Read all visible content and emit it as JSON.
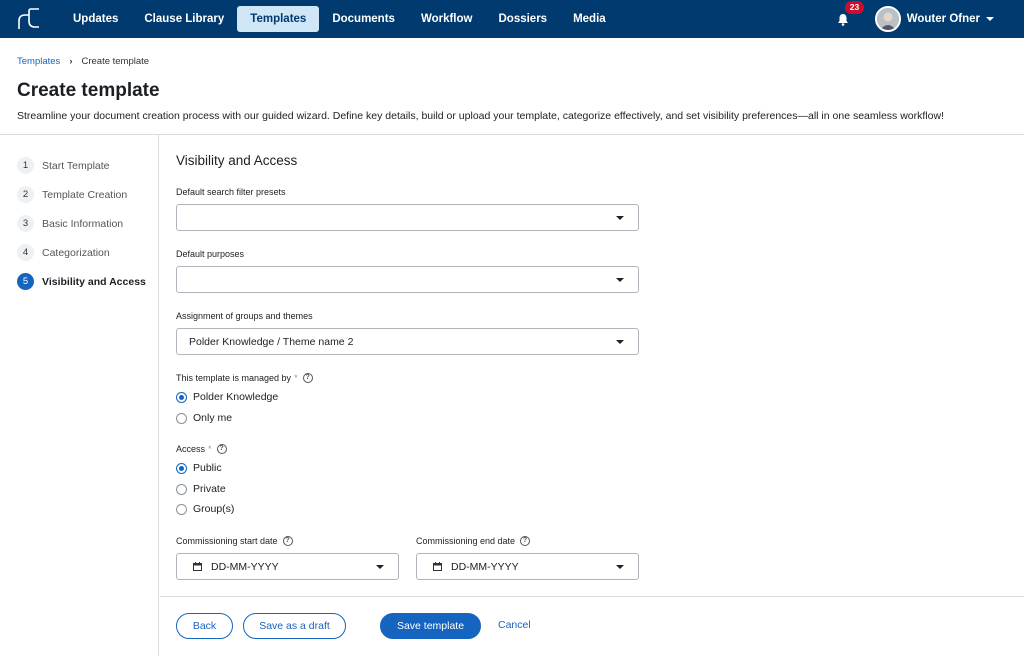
{
  "nav": {
    "items": [
      {
        "label": "Updates",
        "active": false
      },
      {
        "label": "Clause Library",
        "active": false
      },
      {
        "label": "Templates",
        "active": true
      },
      {
        "label": "Documents",
        "active": false
      },
      {
        "label": "Workflow",
        "active": false
      },
      {
        "label": "Dossiers",
        "active": false
      },
      {
        "label": "Media",
        "active": false
      }
    ],
    "notification_count": "23",
    "user_name": "Wouter Ofner"
  },
  "breadcrumb": {
    "parent": "Templates",
    "current": "Create template"
  },
  "page": {
    "title": "Create template",
    "description": "Streamline your document creation process with our guided wizard. Define key details, build or upload your template, categorize effectively, and set visibility preferences—all in one seamless workflow!"
  },
  "steps": [
    {
      "num": "1",
      "label": "Start Template",
      "active": false
    },
    {
      "num": "2",
      "label": "Template Creation",
      "active": false
    },
    {
      "num": "3",
      "label": "Basic Information",
      "active": false
    },
    {
      "num": "4",
      "label": "Categorization",
      "active": false
    },
    {
      "num": "5",
      "label": "Visibility and Access",
      "active": true
    }
  ],
  "form": {
    "section_title": "Visibility and Access",
    "filter_presets": {
      "label": "Default search filter presets",
      "value": ""
    },
    "purposes": {
      "label": "Default purposes",
      "value": ""
    },
    "groups_themes": {
      "label": "Assignment of groups and themes",
      "value": "Polder Knowledge / Theme name 2"
    },
    "managed_by": {
      "label": "This template is managed by",
      "required_mark": "*",
      "options": [
        {
          "label": "Polder Knowledge",
          "checked": true
        },
        {
          "label": "Only me",
          "checked": false
        }
      ]
    },
    "access": {
      "label": "Access",
      "required_mark": "*",
      "options": [
        {
          "label": "Public",
          "checked": true
        },
        {
          "label": "Private",
          "checked": false
        },
        {
          "label": "Group(s)",
          "checked": false
        }
      ]
    },
    "start_date": {
      "label": "Commissioning start date",
      "placeholder": "DD-MM-YYYY"
    },
    "end_date": {
      "label": "Commissioning end date",
      "placeholder": "DD-MM-YYYY"
    }
  },
  "actions": {
    "back": "Back",
    "save_draft": "Save as a draft",
    "save_template": "Save template",
    "cancel": "Cancel"
  },
  "colors": {
    "nav_bg": "#003a6e",
    "accent": "#1565c0",
    "badge": "#c8102e"
  }
}
